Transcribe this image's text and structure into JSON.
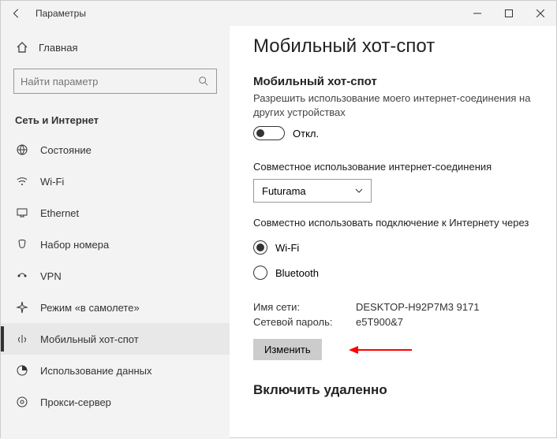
{
  "titlebar": {
    "title": "Параметры"
  },
  "sidebar": {
    "home": "Главная",
    "search_placeholder": "Найти параметр",
    "category": "Сеть и Интернет",
    "items": [
      {
        "label": "Состояние"
      },
      {
        "label": "Wi-Fi"
      },
      {
        "label": "Ethernet"
      },
      {
        "label": "Набор номера"
      },
      {
        "label": "VPN"
      },
      {
        "label": "Режим «в самолете»"
      },
      {
        "label": "Мобильный хот-спот"
      },
      {
        "label": "Использование данных"
      },
      {
        "label": "Прокси-сервер"
      }
    ]
  },
  "main": {
    "heading": "Мобильный хот-спот",
    "hotspot_title": "Мобильный хот-спот",
    "hotspot_desc": "Разрешить использование моего интернет-соединения на других устройствах",
    "toggle_state": "Откл.",
    "share_label": "Совместное использование интернет-соединения",
    "share_value": "Futurama",
    "via_label": "Совместно использовать подключение к Интернету через",
    "radio_wifi": "Wi-Fi",
    "radio_bt": "Bluetooth",
    "net_name_label": "Имя сети:",
    "net_name_value": "DESKTOP-H92P7M3 9171",
    "net_pass_label": "Сетевой пароль:",
    "net_pass_value": "e5T900&7",
    "edit_button": "Изменить",
    "remote_heading": "Включить удаленно"
  }
}
